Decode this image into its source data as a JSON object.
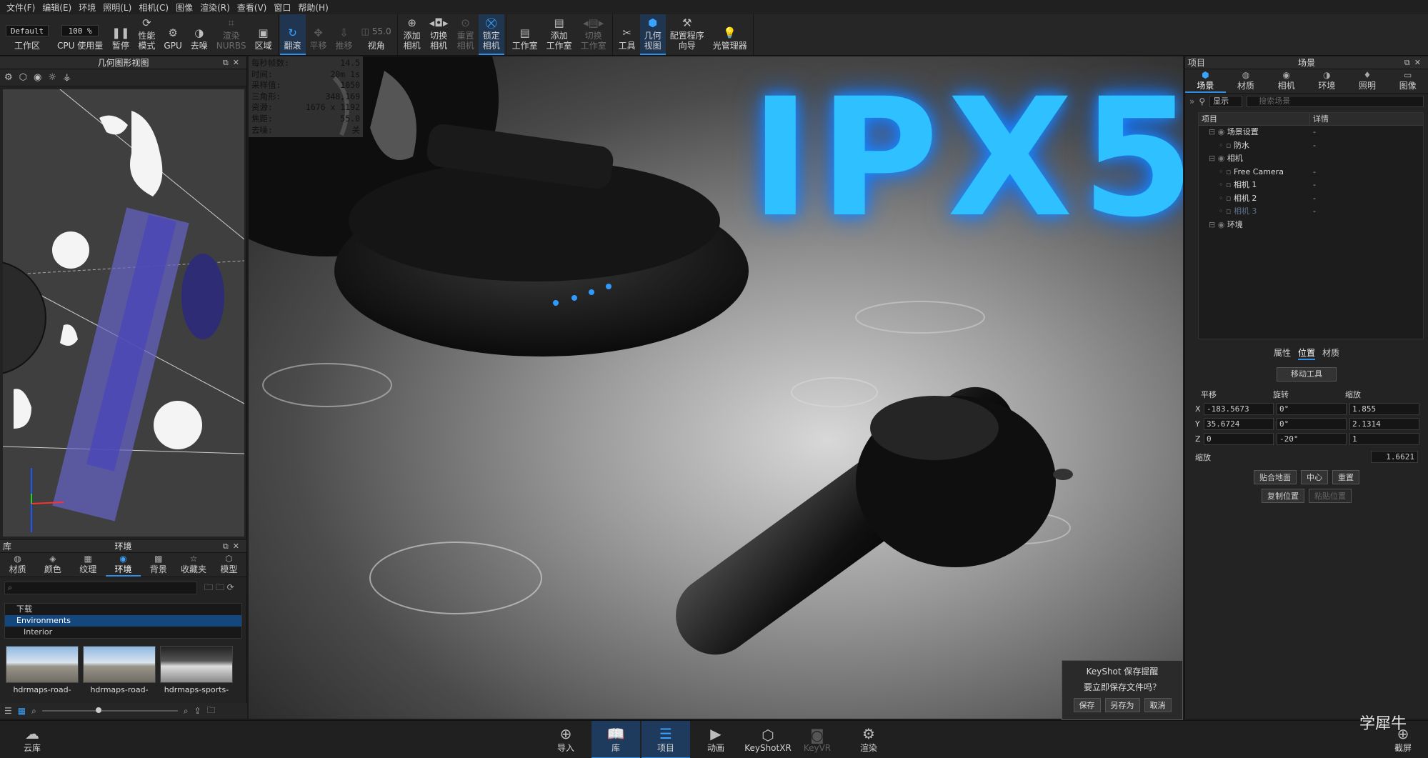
{
  "menu": [
    "文件(F)",
    "编辑(E)",
    "环境",
    "照明(L)",
    "相机(C)",
    "图像",
    "渲染(R)",
    "查看(V)",
    "窗口",
    "帮助(H)"
  ],
  "toolbar": {
    "workspace_value": "Default",
    "workspace_label": "工作区",
    "cpu_usage_value": "100 %",
    "cpu_label": "CPU",
    "usage_label": "使用量",
    "pause_label": "暂停",
    "perf_mode_label": "性能\n模式",
    "gpu_label": "GPU",
    "denoise_label": "去噪",
    "render_nurbs_label": "渲染\nNURBS",
    "region_label": "区域",
    "tumble_label": "翻滚",
    "pan_label": "平移",
    "dolly_label": "推移",
    "fov_value": "55.0",
    "fov_label": "视角",
    "add_camera_label": "添加\n相机",
    "switch_camera_label": "切换\n相机",
    "reset_camera_label": "重置\n相机",
    "lock_camera_label": "锁定\n相机",
    "studio_label": "工作室",
    "add_studio_label": "添加\n工作室",
    "switch_studio_label": "切换\n工作室",
    "tools_label": "工具",
    "geo_view_label": "几何\n视图",
    "config_wizard_label": "配置程序\n向导",
    "light_manager_label": "光管理器"
  },
  "geo_panel": {
    "title": "几何图形视图"
  },
  "stats": [
    {
      "k": "每秒帧数:",
      "v": "14.5"
    },
    {
      "k": "时间:",
      "v": "20m 1s"
    },
    {
      "k": "采样值:",
      "v": "1050"
    },
    {
      "k": "三角形:",
      "v": "348,169"
    },
    {
      "k": "资源:",
      "v": "1676 x 1192"
    },
    {
      "k": "焦距:",
      "v": "55.0"
    },
    {
      "k": "去噪:",
      "v": "关"
    }
  ],
  "viewport": {
    "headline": "IPX5"
  },
  "library": {
    "panel_label": "库",
    "title": "环境",
    "tabs": [
      "材质",
      "颜色",
      "纹理",
      "环境",
      "背景",
      "收藏夹",
      "模型"
    ],
    "active_tab": 3,
    "tree": [
      "下载",
      "Environments",
      "Interior"
    ],
    "selected_tree_index": 1,
    "thumbs": [
      "hdrmaps-road-",
      "hdrmaps-road-",
      "hdrmaps-sports-"
    ]
  },
  "save_dialog": {
    "title": "KeyShot 保存提醒",
    "question": "要立即保存文件吗？",
    "save": "保存",
    "save_as": "另存为",
    "cancel": "取消"
  },
  "project": {
    "panel_label": "项目",
    "title": "场景",
    "tabs": [
      "场景",
      "材质",
      "相机",
      "环境",
      "照明",
      "图像"
    ],
    "active_tab": 0,
    "display_select": "显示",
    "search_placeholder": "搜索场景",
    "col_item": "项目",
    "col_detail": "详情",
    "tree": [
      {
        "name": "场景设置",
        "detail": "-",
        "indent": 1
      },
      {
        "name": "防水",
        "detail": "-",
        "indent": 2
      },
      {
        "name": "相机",
        "detail": "",
        "indent": 1
      },
      {
        "name": "Free Camera",
        "detail": "-",
        "indent": 2
      },
      {
        "name": "相机 1",
        "detail": "-",
        "indent": 2
      },
      {
        "name": "相机 2",
        "detail": "-",
        "indent": 2
      },
      {
        "name": "相机 3",
        "detail": "-",
        "indent": 2,
        "dim": true
      },
      {
        "name": "环境",
        "detail": "",
        "indent": 1
      }
    ],
    "subtabs": [
      "属性",
      "位置",
      "材质"
    ],
    "active_subtab": 1,
    "move_tool": "移动工具",
    "xform_headers": [
      "平移",
      "旋转",
      "缩放"
    ],
    "xform": [
      {
        "axis": "X",
        "t": "-183.5673",
        "r": "0°",
        "s": "1.855"
      },
      {
        "axis": "Y",
        "t": "35.6724",
        "r": "0°",
        "s": "2.1314"
      },
      {
        "axis": "Z",
        "t": "0",
        "r": "-20°",
        "s": "1"
      }
    ],
    "scale_label": "缩放",
    "scale_value": "1.6621",
    "btn_snap": "贴合地面",
    "btn_center": "中心",
    "btn_reset": "重置",
    "btn_copy": "复制位置",
    "btn_paste": "粘贴位置"
  },
  "dock": {
    "cloud": "云库",
    "import": "导入",
    "library": "库",
    "project": "项目",
    "animation": "动画",
    "keyshotxr": "KeyShotXR",
    "keyvr": "KeyVR",
    "render": "渲染",
    "screenshot": "截屏"
  },
  "watermark": "学犀牛"
}
